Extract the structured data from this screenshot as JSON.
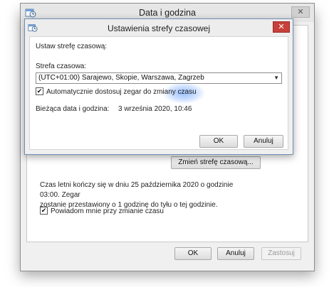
{
  "main_window": {
    "title": "Data i godzina",
    "close_glyph": "✕",
    "change_tz_button": "Zmień strefę czasową...",
    "dst_lines": [
      "Czas letni kończy się w dniu 25 października 2020 o godzinie 03:00. Zegar",
      "zostanie przestawiony o 1 godzinę do tyłu o tej godzinie."
    ],
    "notify_label": "Powiadom mnie przy zmianie czasu",
    "notify_checked": "✔",
    "ok_button": "OK",
    "cancel_button": "Anuluj",
    "apply_button": "Zastosuj"
  },
  "dialog": {
    "title": "Ustawienia strefy czasowej",
    "close_glyph": "✕",
    "set_label": "Ustaw strefę czasową:",
    "tz_label": "Strefa czasowa:",
    "tz_value": "(UTC+01:00) Sarajewo, Skopie, Warszawa, Zagrzeb",
    "tz_arrow": "▼",
    "auto_label": "Automatycznie dostosuj zegar do zmiany czasu",
    "auto_checked": "✔",
    "current_label": "Bieżąca data i godzina:",
    "current_value": "3 września 2020, 10:46",
    "ok_button": "OK",
    "cancel_button": "Anuluj"
  },
  "colors": {
    "close_red": "#c7403a",
    "window_bg": "#f0f0f0",
    "highlight_glow": "#468cff"
  },
  "icons": [
    "clock-calendar-icon",
    "close-icon",
    "checkbox-checked-icon",
    "dropdown-arrow-icon"
  ]
}
